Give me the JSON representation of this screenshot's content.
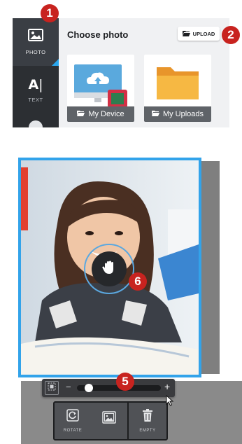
{
  "markers": [
    "1",
    "2",
    "5",
    "6"
  ],
  "sidebar": {
    "photo_label": "PHOTO",
    "text_label": "TEXT",
    "photo_icon": "image-icon",
    "text_icon": "text-cursor-icon"
  },
  "panel": {
    "title": "Choose photo",
    "upload_label": "UPLOAD",
    "tiles": [
      {
        "label": "My Device",
        "icon": "monitor-cloud-icon"
      },
      {
        "label": "My Uploads",
        "icon": "folder-icon"
      }
    ]
  },
  "editor": {
    "move_icon": "hand-icon",
    "zoom_minus": "−",
    "zoom_plus": "+",
    "zoom_level": 0.1,
    "tools": [
      {
        "label": "ROTATE",
        "icon": "rotate-icon"
      },
      {
        "label": "",
        "icon": "image-replace-icon"
      },
      {
        "label": "EMPTY",
        "icon": "trash-icon"
      }
    ]
  },
  "colors": {
    "accent": "#32a3ea",
    "marker": "#c8231f",
    "rail": "#2c2f33"
  }
}
